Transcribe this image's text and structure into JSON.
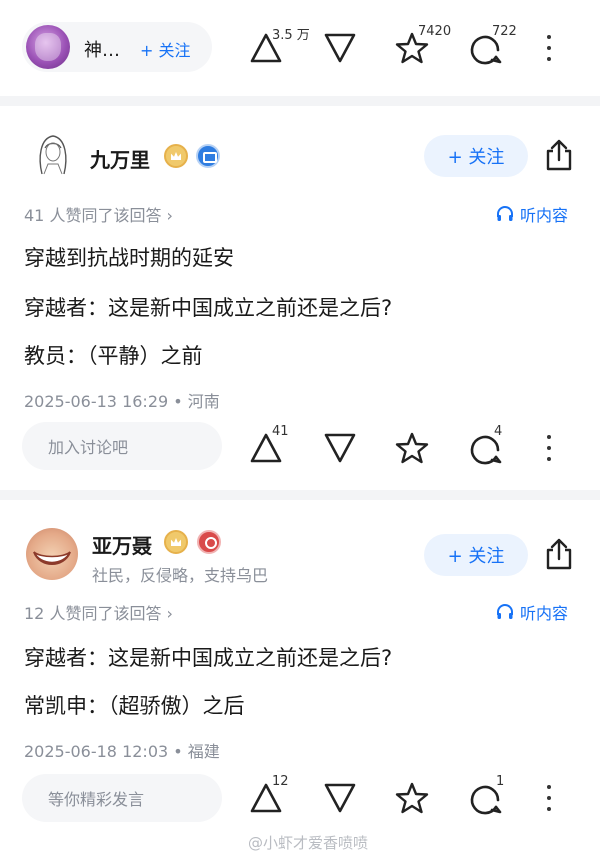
{
  "top_bar": {
    "author_name": "神…",
    "follow_label": "+ 关注",
    "upvote_count": "3.5 万",
    "favorite_count": "7420",
    "comment_count": "722"
  },
  "answers": [
    {
      "username": "九万里",
      "tagline": "",
      "follow_label": "+ 关注",
      "agree_text": "41 人赞同了该回答 ›",
      "listen_label": "听内容",
      "lines": [
        "穿越到抗战时期的延安",
        "穿越者：这是新中国成立之前还是之后?",
        "教员：（平静）之前"
      ],
      "meta": "2025-06-13 16:29 • 河南",
      "comment_placeholder": "加入讨论吧",
      "upvote_count": "41",
      "comment_count": "4"
    },
    {
      "username": "亚万聂",
      "tagline": "社民，反侵略，支持乌巴",
      "follow_label": "+ 关注",
      "agree_text": "12 人赞同了该回答 ›",
      "listen_label": "听内容",
      "lines": [
        "穿越者：这是新中国成立之前还是之后?",
        "常凯申：（超骄傲）之后"
      ],
      "meta": "2025-06-18 12:03 • 福建",
      "comment_placeholder": "等你精彩发言",
      "upvote_count": "12",
      "comment_count": "1"
    }
  ],
  "watermark": "@小虾才爱香喷喷",
  "colors": {
    "accent": "#1772f6",
    "muted": "#8a8f99",
    "divider": "#f3f4f6"
  },
  "icons": [
    "upvote-icon",
    "downvote-icon",
    "star-icon",
    "comment-icon",
    "more-icon",
    "share-icon",
    "headphones-icon"
  ]
}
